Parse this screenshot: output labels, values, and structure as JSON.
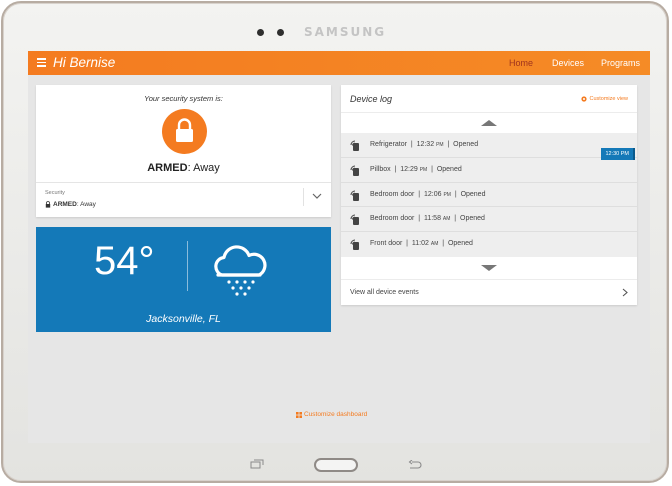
{
  "device": {
    "brand": "SAMSUNG"
  },
  "header": {
    "greeting": "Hi Bernise",
    "nav": [
      {
        "label": "Home",
        "active": true
      },
      {
        "label": "Devices",
        "active": false
      },
      {
        "label": "Programs",
        "active": false
      }
    ]
  },
  "security": {
    "heading": "Your security system is:",
    "status_bold": "ARMED",
    "status_rest": ": Away",
    "section_label": "Security",
    "small_status_bold": "ARMED",
    "small_status_rest": ": Away"
  },
  "weather": {
    "temperature": "54°",
    "location": "Jacksonville, FL",
    "icon": "rain-cloud-icon"
  },
  "device_log": {
    "title": "Device log",
    "customize_label": "Customize view",
    "marker_time": "12:30",
    "marker_period": "PM",
    "entries": [
      {
        "device": "Refrigerator",
        "time": "12:32",
        "period": "PM",
        "event": "Opened"
      },
      {
        "device": "Pillbox",
        "time": "12:29",
        "period": "PM",
        "event": "Opened"
      },
      {
        "device": "Bedroom door",
        "time": "12:06",
        "period": "PM",
        "event": "Opened"
      },
      {
        "device": "Bedroom door",
        "time": "11:58",
        "period": "AM",
        "event": "Opened"
      },
      {
        "device": "Front door",
        "time": "11:02",
        "period": "AM",
        "event": "Opened"
      }
    ],
    "view_all_label": "View all device events"
  },
  "footer": {
    "customize_dashboard": "Customize dashboard"
  },
  "colors": {
    "accent": "#f47b20",
    "weather_bg": "#1479b8",
    "nav_active": "#a0341e"
  }
}
